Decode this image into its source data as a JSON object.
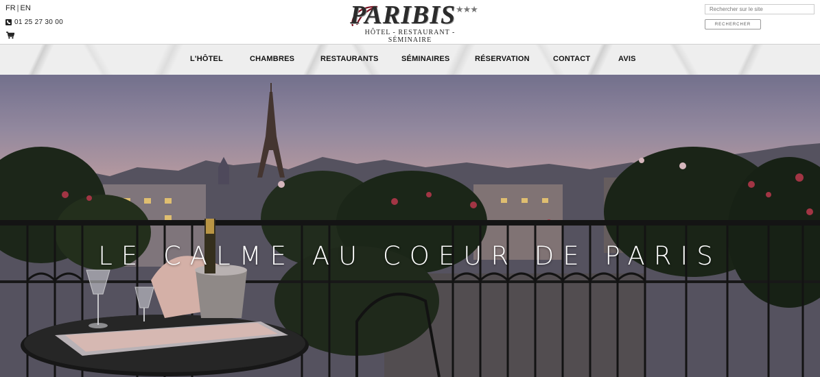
{
  "header": {
    "lang": {
      "fr": "FR",
      "separator": "|",
      "en": "EN"
    },
    "phone": "01 25 27 30 00",
    "icons": {
      "phone": "phone-icon",
      "cart": "cart-icon"
    },
    "logo": {
      "name": "PARIBIS",
      "stars": "★★★",
      "tagline": "HÔTEL - RESTAURANT - SÉMINAIRE"
    },
    "search": {
      "placeholder": "Rechercher sur le site",
      "button_label": "RECHERCHER"
    }
  },
  "nav": {
    "items": [
      {
        "label": "L'HÔTEL"
      },
      {
        "label": "CHAMBRES"
      },
      {
        "label": "RESTAURANTS"
      },
      {
        "label": "SÉMINAIRES"
      },
      {
        "label": "RÉSERVATION"
      },
      {
        "label": "CONTACT"
      },
      {
        "label": "AVIS"
      }
    ]
  },
  "hero": {
    "title": "LE CALME AU COEUR DE PARIS"
  },
  "colors": {
    "text": "#111111",
    "nav_background": "#eeeeee",
    "hero_title": "#ffffff"
  }
}
